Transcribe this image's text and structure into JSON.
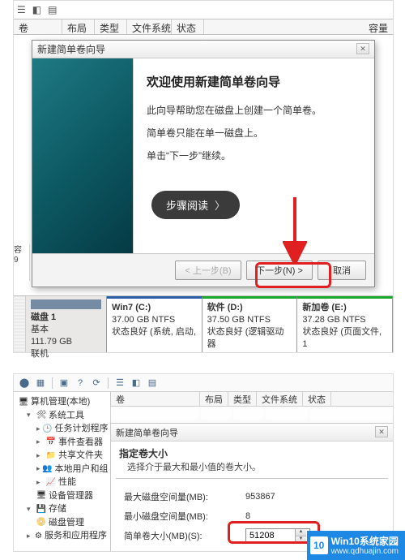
{
  "top": {
    "title": "新建简单卷向导",
    "table_header": {
      "vol": "卷",
      "layout": "布局",
      "type": "类型",
      "fs": "文件系统",
      "status": "状态",
      "capacity": "容量"
    },
    "wizard": {
      "heading": "欢迎使用新建简单卷向导",
      "line1": "此向导帮助您在磁盘上创建一个简单卷。",
      "line2": "简单卷只能在单一磁盘上。",
      "line3": "单击“下一步”继续。",
      "step_btn": "步骤阅读",
      "back": "< 上一步(B)",
      "next": "下一步(N) >",
      "cancel": "取消"
    },
    "left_rail": {
      "a": "容",
      "b": "9"
    },
    "disk": {
      "name": "磁盘 1",
      "kind": "基本",
      "size": "111.79 GB",
      "state": "联机",
      "parts": [
        {
          "title": "Win7  (C:)",
          "l2": "37.00 GB NTFS",
          "l3": "状态良好 (系统, 启动,"
        },
        {
          "title": "软件  (D:)",
          "l2": "37.50 GB NTFS",
          "l3": "状态良好 (逻辑驱动器"
        },
        {
          "title": "新加卷  (E:)",
          "l2": "37.28 GB NTFS",
          "l3": "状态良好 (页面文件, 1"
        }
      ]
    }
  },
  "bottom": {
    "header": {
      "vol": "卷",
      "layout": "布局",
      "type": "类型",
      "fs": "文件系统",
      "status": "状态"
    },
    "wizard_title": "新建简单卷向导",
    "tree": {
      "root": "算机管理(本地)",
      "n0": "系统工具",
      "n1": "任务计划程序",
      "n2": "事件查看器",
      "n3": "共享文件夹",
      "n4": "本地用户和组",
      "n5": "性能",
      "n6": "设备管理器",
      "n7": "存储",
      "n8": "磁盘管理",
      "n9": "服务和应用程序"
    },
    "size": {
      "heading": "指定卷大小",
      "sub": "选择介于最大和最小值的卷大小。",
      "max_lbl": "最大磁盘空间量(MB):",
      "max_val": "953867",
      "min_lbl": "最小磁盘空间量(MB):",
      "min_val": "8",
      "vol_lbl": "简单卷大小(MB)(S):",
      "vol_val": "51208"
    }
  },
  "watermark": {
    "logo": "10",
    "line1": "Win10系统家园",
    "line2": "www.qdhuajin.com"
  }
}
